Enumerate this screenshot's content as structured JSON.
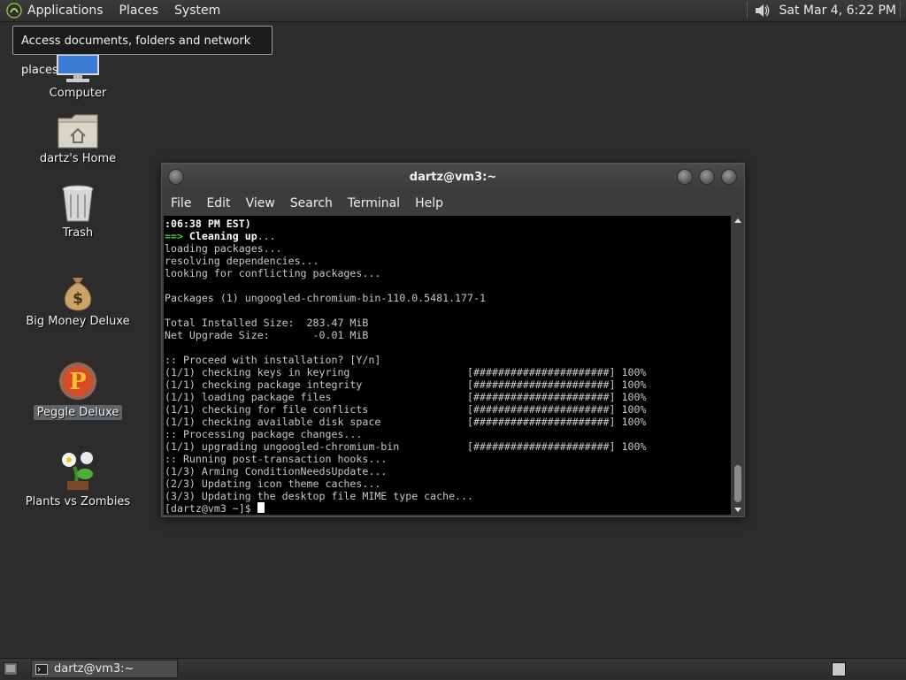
{
  "top_panel": {
    "menus": [
      "Applications",
      "Places",
      "System"
    ],
    "clock": "Sat Mar  4,  6:22 PM"
  },
  "tooltip": "Access documents, folders and network places",
  "desktop_icons": [
    {
      "label": "Computer"
    },
    {
      "label": "dartz's Home"
    },
    {
      "label": "Trash"
    },
    {
      "label": "Big Money Deluxe"
    },
    {
      "label": "Peggle Deluxe"
    },
    {
      "label": "Plants vs Zombies"
    }
  ],
  "terminal": {
    "title": "dartz@vm3:~",
    "menu": [
      "File",
      "Edit",
      "View",
      "Search",
      "Terminal",
      "Help"
    ],
    "lines": [
      ":06:38 PM EST)",
      "==> Cleaning up...",
      "loading packages...",
      "resolving dependencies...",
      "looking for conflicting packages...",
      "",
      "Packages (1) ungoogled-chromium-bin-110.0.5481.177-1",
      "",
      "Total Installed Size:  283.47 MiB",
      "Net Upgrade Size:       -0.01 MiB",
      "",
      ":: Proceed with installation? [Y/n]",
      "(1/1) checking keys in keyring                   [######################] 100%",
      "(1/1) checking package integrity                 [######################] 100%",
      "(1/1) loading package files                      [######################] 100%",
      "(1/1) checking for file conflicts                [######################] 100%",
      "(1/1) checking available disk space              [######################] 100%",
      ":: Processing package changes...",
      "(1/1) upgrading ungoogled-chromium-bin           [######################] 100%",
      ":: Running post-transaction hooks...",
      "(1/3) Arming ConditionNeedsUpdate...",
      "(2/3) Updating icon theme caches...",
      "(3/3) Updating the desktop file MIME type cache...",
      "[dartz@vm3 ~]$ "
    ]
  },
  "taskbar": {
    "task_label": "dartz@vm3:~"
  }
}
